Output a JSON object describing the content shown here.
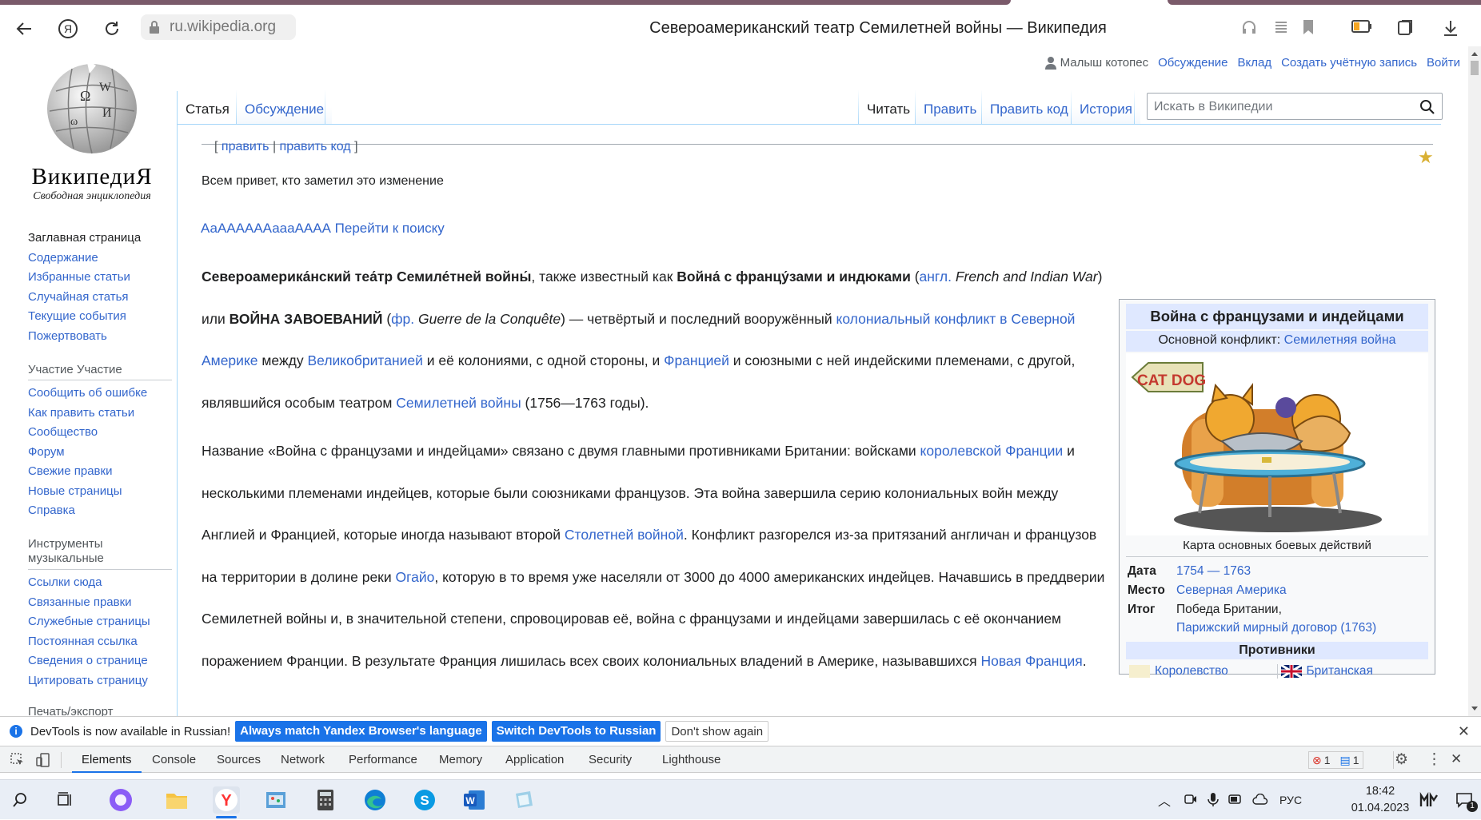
{
  "browser": {
    "url": "ru.wikipedia.org",
    "title": "Североамериканский театр Семилетней войны — Википедия"
  },
  "wiki": {
    "logo_name": "ВикипедиЯ",
    "logo_sub": "Свободная энциклопедия",
    "nav_main": [
      "Заглавная страница",
      "Содержание",
      "Избранные статьи",
      "Случайная статья",
      "Текущие события",
      "Пожертвовать"
    ],
    "nav_participation_header": "Участие Участие",
    "nav_participation": [
      "Сообщить об ошибке",
      "Как править статьи",
      "Сообщество",
      "Форум",
      "Свежие правки",
      "Новые страницы",
      "Справка"
    ],
    "nav_tools_header": "Инструменты музыкальные",
    "nav_tools": [
      "Ссылки сюда",
      "Связанные правки",
      "Служебные страницы",
      "Постоянная ссылка",
      "Сведения о странице",
      "Цитировать страницу"
    ],
    "nav_print_header": "Печать/экспорт",
    "user": {
      "name": "Малыш котопес",
      "discussion": "Обсуждение",
      "contrib": "Вклад",
      "create": "Создать учётную запись",
      "login": "Войти"
    },
    "tabs": {
      "article": "Статья",
      "talk": "Обсуждение",
      "read": "Читать",
      "edit": "Править",
      "edit_source": "Править код",
      "history": "История"
    },
    "search_placeholder": "Искать в Википедии",
    "editlinks": {
      "open": "[",
      "edit": "правит",
      "sep": "|",
      "edit_source": "править код",
      "close": "]"
    },
    "greeting": "Всем привет, кто заметил это изменение",
    "jump": {
      "prefix": "АаААААААаааАААА",
      "link": "Перейти к поиску"
    },
    "p1": {
      "b1": "Североамерика́нский теа́тр Семиле́тней войны́",
      "t1": ", также известный как ",
      "b2": "Война́ с францу́зами и индюками",
      "t2": " (",
      "l_eng": "англ.",
      "i1": " French and Indian War",
      "t3": ") или ",
      "b3": "ВОЙНА ЗАВОЕВАНИЙ",
      "t4": " (",
      "l_fr": "фр.",
      "i2": " Guerre de la Conquête",
      "t5": ") — четвёртый и последний вооружённый ",
      "l1": "колониальный конфликт в Северной Америке",
      "t6": " между ",
      "l2": "Великобританией",
      "t7": " и её колониями, с одной стороны, и ",
      "l3": "Францией",
      "t8": " и союзными с ней индейскими племенами, с другой, являвшийся особым театром ",
      "l4": "Семилетней войны",
      "t9": " (1756—1763 годы)."
    },
    "p2": {
      "t1": "Название «Война с французами и индейцами» связано с двумя главными противниками Британии: войсками ",
      "l1": "королевской Франции",
      "t2": " и несколькими племенами индейцев, которые были союзниками французов. Эта война завершила серию колониальных войн между Англией и Францией, которые иногда называют второй ",
      "l2": "Столетней войной",
      "t3": ". Конфликт разгорелся из-за притязаний англичан и французов на территории в долине реки ",
      "l3": "Огайо",
      "t4": ", которую в то время уже населяли от 3000 до 4000 американских индейцев. Начавшись в преддверии Семилетней войны и, в значительной степени, спровоцировав её, война с французами и индейцами завершилась с её окончанием поражением Франции. В результате Франция лишилась всех своих колониальных владений в Америке, называвшихся ",
      "l4": "Новая Франция",
      "t5": "."
    },
    "infobox": {
      "title": "Война с французами и индейцами",
      "sub_prefix": "Основной конфликт:",
      "sub_link": "Семилетняя война",
      "image_text": "CAT DOG",
      "caption": "Карта основных боевых действий",
      "date_k": "Дата",
      "date_v": "1754 — 1763",
      "place_k": "Место",
      "place_v": "Северная Америка",
      "result_k": "Итог",
      "result_v1": "Победа Британии,",
      "result_v2": "Парижский мирный договор (1763)",
      "opponents": "Противники",
      "side1": "Королевство",
      "side2": "Британская"
    }
  },
  "devtools": {
    "notice": "DevTools is now available in Russian!",
    "btn_match": "Always match Yandex Browser's language",
    "btn_switch": "Switch DevTools to Russian",
    "btn_dont": "Don't show again",
    "tabs": [
      "Elements",
      "Console",
      "Sources",
      "Network",
      "Performance",
      "Memory",
      "Application",
      "Security",
      "Lighthouse"
    ],
    "errors": "1",
    "messages": "1"
  },
  "taskbar": {
    "lang": "РУС",
    "time": "18:42",
    "date": "01.04.2023",
    "notif_count": "1"
  }
}
